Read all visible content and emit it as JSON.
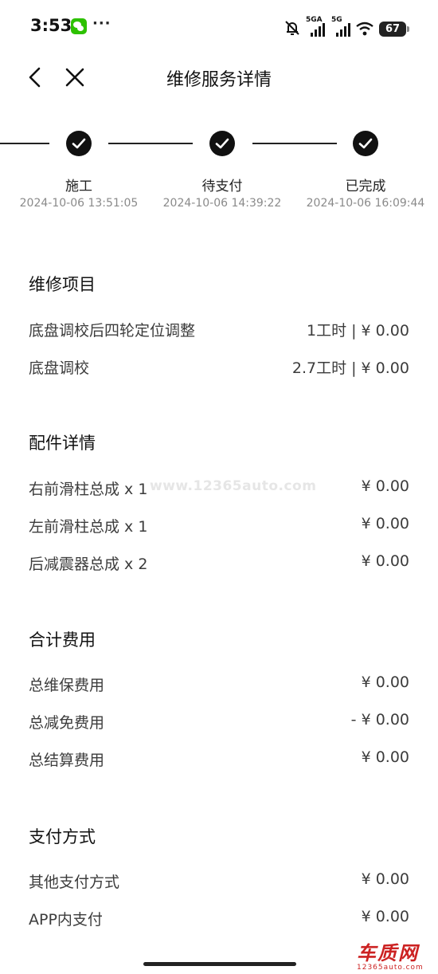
{
  "status_bar": {
    "time": "3:53",
    "more": "···",
    "network1": "5GA",
    "network2": "5G",
    "battery": "67"
  },
  "header": {
    "title": "维修服务详情"
  },
  "progress": {
    "steps": [
      {
        "label": "施工",
        "time": "2024-10-06 13:51:05"
      },
      {
        "label": "待支付",
        "time": "2024-10-06 14:39:22"
      },
      {
        "label": "已完成",
        "time": "2024-10-06 16:09:44"
      }
    ]
  },
  "repair": {
    "title": "维修项目",
    "items": [
      {
        "name": "底盘调校后四轮定位调整",
        "value": "1工时 | ¥ 0.00"
      },
      {
        "name": "底盘调校",
        "value": "2.7工时 | ¥ 0.00"
      }
    ]
  },
  "parts": {
    "title": "配件详情",
    "items": [
      {
        "name": "右前滑柱总成 x 1",
        "value": "¥ 0.00"
      },
      {
        "name": "左前滑柱总成 x 1",
        "value": "¥ 0.00"
      },
      {
        "name": "后减震器总成 x 2",
        "value": "¥ 0.00"
      }
    ]
  },
  "totals": {
    "title": "合计费用",
    "items": [
      {
        "name": "总维保费用",
        "value": "¥ 0.00"
      },
      {
        "name": "总减免费用",
        "value": "- ¥ 0.00"
      },
      {
        "name": "总结算费用",
        "value": "¥ 0.00"
      }
    ]
  },
  "payment": {
    "title": "支付方式",
    "items": [
      {
        "name": "其他支付方式",
        "value": "¥ 0.00"
      },
      {
        "name": "APP内支付",
        "value": "¥ 0.00"
      }
    ]
  },
  "watermark": "www.12365auto.com",
  "logo": {
    "main": "车质网",
    "sub": "12365auto.com"
  }
}
